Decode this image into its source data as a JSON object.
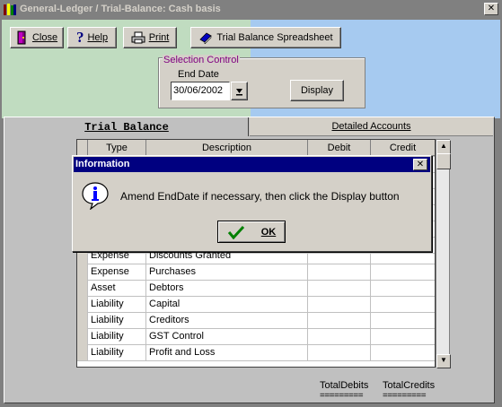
{
  "window": {
    "title": "General-Ledger / Trial-Balance:  Cash basis",
    "close_glyph": "✕"
  },
  "toolbar": {
    "close_label": "Close",
    "help_label": "Help",
    "print_label": "Print",
    "spreadsheet_label": "Trial Balance Spreadsheet"
  },
  "selection": {
    "group_title": "Selection Control",
    "end_date_label": "End Date",
    "end_date_value": "30/06/2002",
    "display_label": "Display"
  },
  "tabs": {
    "trial_balance": "Trial Balance",
    "detailed_accounts": "Detailed Accounts"
  },
  "grid": {
    "headers": [
      "Type",
      "Description",
      "Debit",
      "Credit"
    ],
    "rows": [
      {
        "type": "Expense",
        "description": "Discounts Granted"
      },
      {
        "type": "Expense",
        "description": "Purchases"
      },
      {
        "type": "Asset",
        "description": "Debtors"
      },
      {
        "type": "Liability",
        "description": "Capital"
      },
      {
        "type": "Liability",
        "description": "Creditors"
      },
      {
        "type": "Liability",
        "description": "GST Control"
      },
      {
        "type": "Liability",
        "description": "Profit and Loss"
      }
    ]
  },
  "totals": {
    "debits_label": "TotalDebits",
    "credits_label": "TotalCredits",
    "debits_rule": "=========",
    "credits_rule": "========="
  },
  "dialog": {
    "title": "Information",
    "message": "Amend EndDate if necessary, then click the Display button",
    "ok_label": "OK",
    "close_glyph": "✕"
  },
  "colors": {
    "title_bar": "#808080",
    "dialog_title_bar": "#000080",
    "left_background": "#c0dcc0",
    "right_background": "#a6caf0",
    "group_title": "#800080"
  }
}
